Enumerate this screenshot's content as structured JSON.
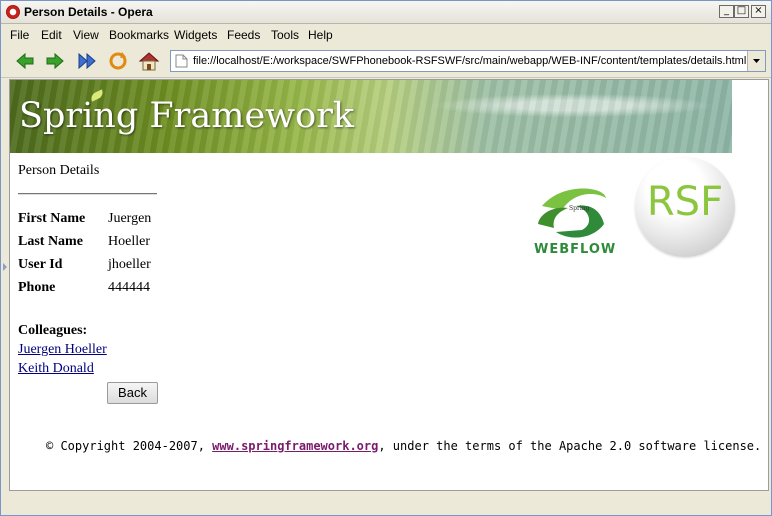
{
  "window": {
    "title": "Person Details - Opera",
    "controls": [
      "_",
      "□",
      "×"
    ]
  },
  "menu": {
    "items": [
      "File",
      "Edit",
      "View",
      "Bookmarks",
      "Widgets",
      "Feeds",
      "Tools",
      "Help"
    ]
  },
  "toolbar": {
    "icons": [
      "back-arrow-icon",
      "forward-arrow-icon",
      "fast-forward-icon",
      "reload-icon",
      "home-icon"
    ]
  },
  "address": {
    "url": "file://localhost/E:/workspace/SWFPhonebook-RSFSWF/src/main/webapp/WEB-INF/content/templates/details.html"
  },
  "banner": {
    "title": "Spring Framework"
  },
  "page": {
    "heading": "Person Details",
    "fields": [
      {
        "label": "First Name",
        "value": "Juergen"
      },
      {
        "label": "Last Name",
        "value": "Hoeller"
      },
      {
        "label": "User Id",
        "value": "jhoeller"
      },
      {
        "label": "Phone",
        "value": "444444"
      }
    ],
    "colleagues_label": "Colleagues:",
    "colleagues": [
      "Juergen Hoeller",
      "Keith Donald"
    ],
    "back_label": "Back"
  },
  "logos": {
    "webflow_small": "Spring",
    "webflow_text": "WEBFLOW",
    "rsf_text": "RSF"
  },
  "footer": {
    "prefix": "© Copyright 2004-2007, ",
    "link": "www.springframework.org",
    "suffix": ", under the terms of the Apache 2.0 software license."
  }
}
